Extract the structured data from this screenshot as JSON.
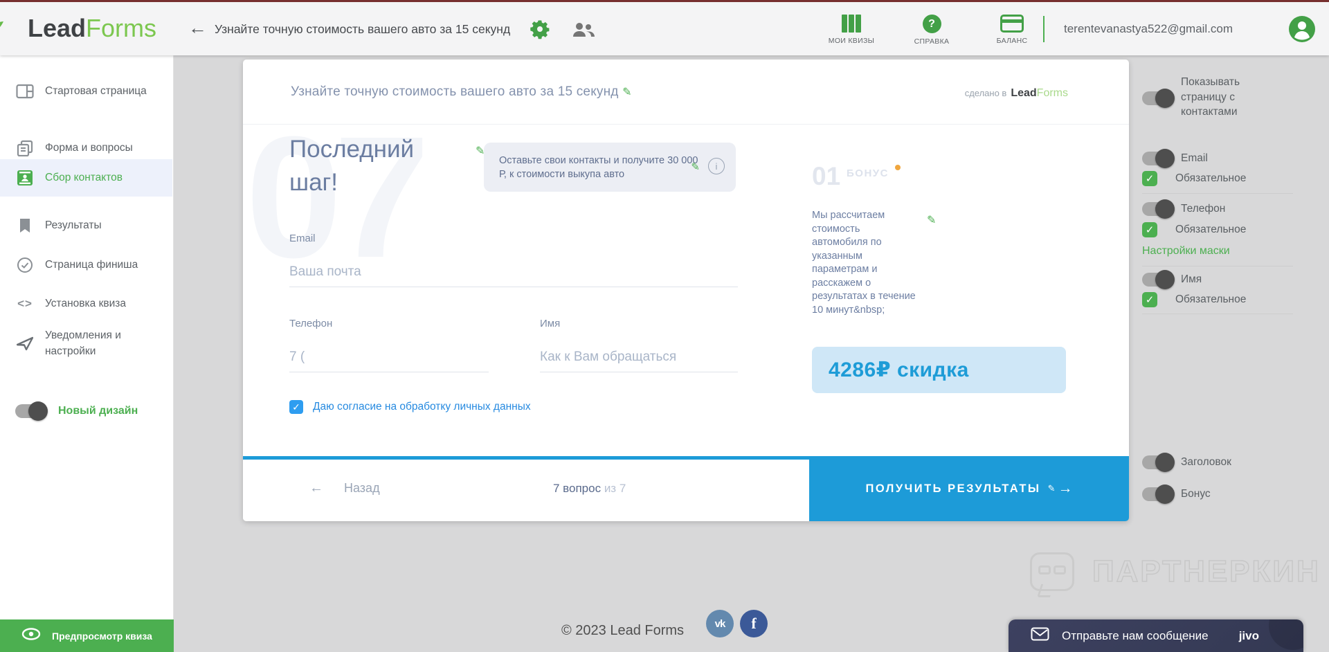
{
  "header": {
    "logo_lead": "Lead",
    "logo_forms": "Forms",
    "quiz_title": "Узнайте точную стоимость вашего авто за 15 секунд",
    "nav": [
      {
        "label": "МОИ КВИЗЫ"
      },
      {
        "label": "СПРАВКА"
      },
      {
        "label": "БАЛАНС"
      }
    ],
    "user_email": "terentevanastya522@gmail.com"
  },
  "sidebar": {
    "items": [
      {
        "label": "Стартовая страница"
      },
      {
        "label": "Форма и вопросы"
      },
      {
        "label": "Сбор контактов"
      },
      {
        "label": "Результаты"
      },
      {
        "label": "Страница финиша"
      },
      {
        "label": "Установка квиза"
      },
      {
        "label": "Уведомления и настройки"
      }
    ],
    "new_design_label": "Новый дизайн",
    "preview_button": "Предпросмотр квиза"
  },
  "quiz": {
    "title": "Узнайте точную стоимость вашего авто за 15 секунд",
    "made_in_prefix": "сделано в",
    "watermark_number": "07",
    "step_heading": "Последний шаг!",
    "tooltip_text": "Оставьте свои контакты и получите 30 000 Р, к стоимости выкупа авто",
    "fields": {
      "email": {
        "label": "Email",
        "placeholder": "Ваша почта"
      },
      "phone": {
        "label": "Телефон",
        "placeholder": "7 ("
      },
      "name": {
        "label": "Имя",
        "placeholder": "Как к Вам обращаться"
      }
    },
    "consent_label": "Даю согласие на обработку личных данных",
    "bonus": {
      "number": "01",
      "label": "БОНУС",
      "text": "Мы рассчитаем стоимость автомобиля по указанным параметрам и расскажем о результатах в течение 10 минут&nbsp;",
      "discount": "4286₽ скидка"
    },
    "footer": {
      "back_label": "Назад",
      "progress_current": "7  вопрос ",
      "progress_rest": "из 7",
      "submit_label": "ПОЛУЧИТЬ РЕЗУЛЬТАТЫ"
    }
  },
  "settings": {
    "show_contacts_label": "Показывать страницу с контактами",
    "required_label": "Обязательное",
    "email_label": "Email",
    "phone_label": "Телефон",
    "mask_link": "Настройки маски",
    "name_label": "Имя",
    "heading_label": "Заголовок",
    "bonus_label": "Бонус"
  },
  "page_footer": {
    "copyright": "© 2023 Lead Forms",
    "vk": "vk",
    "fb": "f"
  },
  "partnerkin_watermark": "ПАРТНЕРКИН",
  "chat": {
    "message": "Отправьте нам сообщение",
    "brand": "jivo"
  },
  "glyphs": {
    "pencil": "✎",
    "back_arrow": "←",
    "forward_arrow": "→",
    "check": "✓",
    "code": "<>",
    "question": "?",
    "info": "i"
  },
  "colors": {
    "brand_green": "#4caf50",
    "accent_blue": "#1d9bd8",
    "consent_blue": "#2e9df0",
    "bonus_dot_orange": "#f0a63e"
  }
}
